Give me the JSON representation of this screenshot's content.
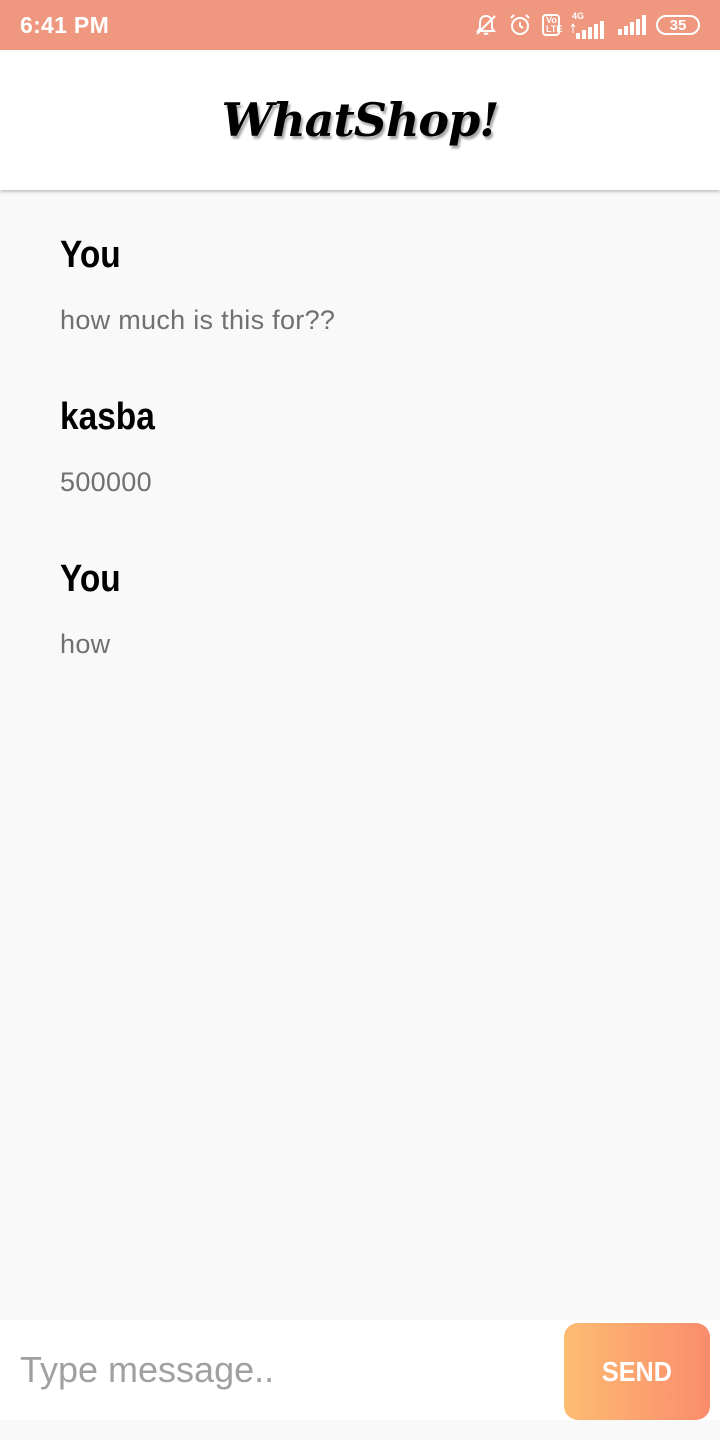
{
  "status_bar": {
    "time": "6:41 PM",
    "network_label": "4G",
    "volte_top": "Vo",
    "volte_bottom": "LTE",
    "battery_level": "35",
    "icons": [
      "mute-icon",
      "alarm-icon",
      "volte-icon",
      "signal-4g-icon",
      "signal-icon",
      "battery-icon"
    ]
  },
  "header": {
    "title": "WhatShop!"
  },
  "messages": [
    {
      "sender": "You",
      "text": "how much is this for??"
    },
    {
      "sender": "kasba",
      "text": "500000"
    },
    {
      "sender": "You",
      "text": "how"
    }
  ],
  "composer": {
    "placeholder": "Type message..",
    "value": "",
    "send_label": "SEND"
  },
  "colors": {
    "status_bar": "#ef987f",
    "send_gradient_start": "#fdbc72",
    "send_gradient_end": "#fa8c6c",
    "background": "#f9f9f9"
  }
}
